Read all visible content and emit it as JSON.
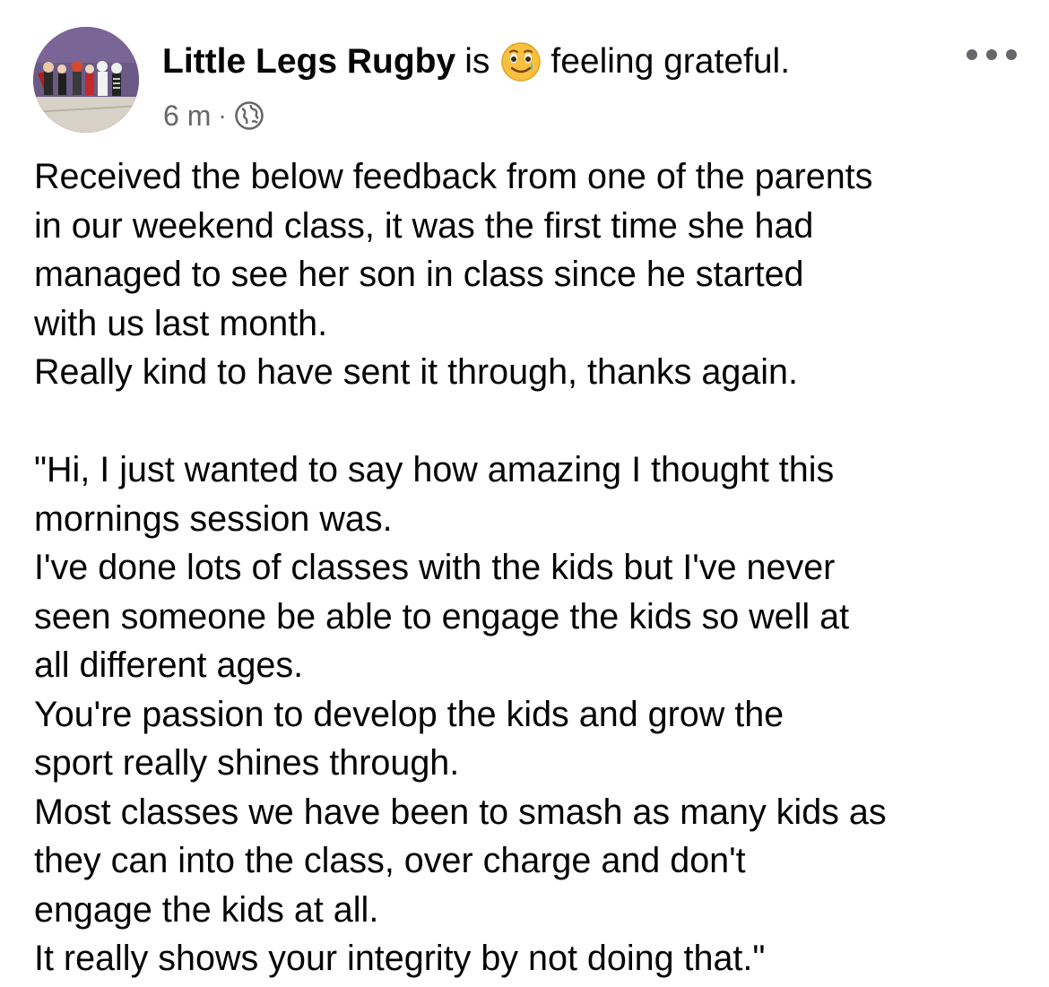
{
  "post": {
    "author": "Little Legs Rugby",
    "is_word": "is",
    "feeling_text": "feeling grateful.",
    "feeling_icon": "smiling-face-with-tear-emoji",
    "timestamp": "6 m",
    "separator": "·",
    "audience_icon": "globe-icon",
    "more_icon": "more-options-icon",
    "body_lines": [
      "Received the below feedback from one of the parents",
      "in our weekend class, it was the first time she had",
      "managed to see her son in class since he started",
      "with us last month.",
      "Really kind to have sent it through, thanks again.",
      "",
      "\"Hi, I just wanted to say how amazing I thought this",
      "mornings session was.",
      "I've done lots of classes with the kids but I've never",
      "seen someone be able to engage the kids so well at",
      "all different ages.",
      "You're passion to develop the kids and grow the",
      "sport really shines through.",
      "Most classes we have been to smash as many kids as",
      "they can into the class, over charge and don't",
      "engage the kids at all.",
      "It really shows  your integrity by not doing that.\""
    ]
  },
  "colors": {
    "text": "#050505",
    "secondary_text": "#65676b",
    "background": "#ffffff",
    "avatar_wall": "#6b5a86",
    "avatar_floor": "#d8d2c6",
    "emoji_face": "#f7c13e"
  }
}
